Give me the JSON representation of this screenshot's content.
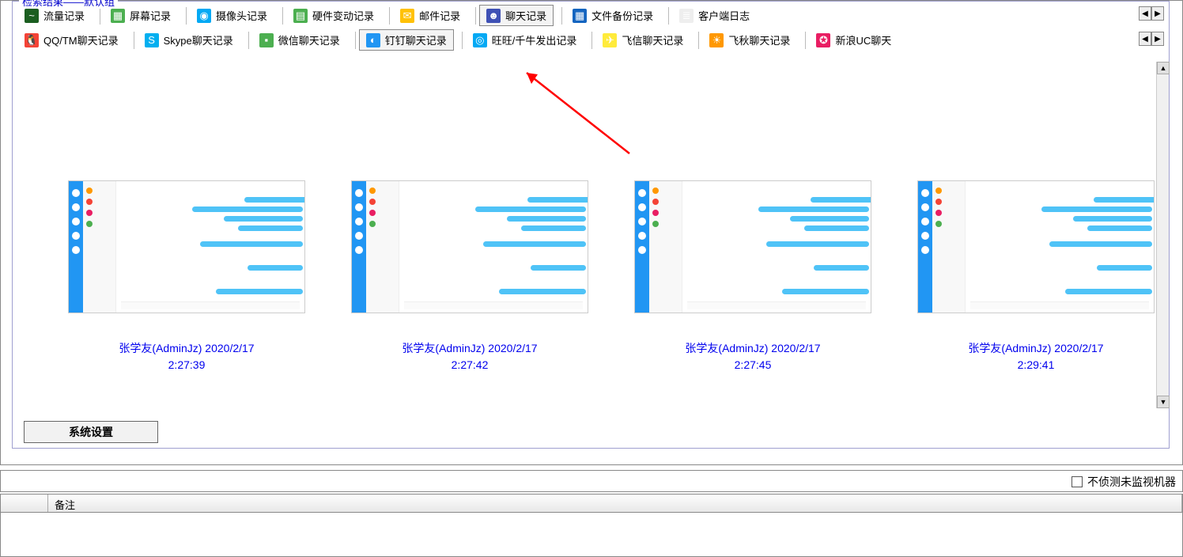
{
  "group_title": "检索结果——默认组",
  "toolbar_row1": [
    {
      "icon_bg": "#1b5e20",
      "icon_txt": "~",
      "label": "流量记录"
    },
    {
      "icon_bg": "#4caf50",
      "icon_txt": "▦",
      "label": "屏幕记录"
    },
    {
      "icon_bg": "#03a9f4",
      "icon_txt": "◉",
      "label": "摄像头记录"
    },
    {
      "icon_bg": "#4caf50",
      "icon_txt": "▤",
      "label": "硬件变动记录"
    },
    {
      "icon_bg": "#ffc107",
      "icon_txt": "✉",
      "label": "邮件记录"
    },
    {
      "icon_bg": "#3f51b5",
      "icon_txt": "☻",
      "label": "聊天记录",
      "active": true
    },
    {
      "icon_bg": "#1565c0",
      "icon_txt": "▦",
      "label": "文件备份记录"
    },
    {
      "icon_bg": "#eeeeee",
      "icon_txt": "≣",
      "label": "客户端日志"
    }
  ],
  "toolbar_row2": [
    {
      "icon_bg": "#f44336",
      "icon_txt": "🐧",
      "label": "QQ/TM聊天记录"
    },
    {
      "icon_bg": "#00aff0",
      "icon_txt": "S",
      "label": "Skype聊天记录"
    },
    {
      "icon_bg": "#4caf50",
      "icon_txt": "▪",
      "label": "微信聊天记录"
    },
    {
      "icon_bg": "#2196f3",
      "icon_txt": "◐",
      "label": "钉钉聊天记录",
      "active": true
    },
    {
      "icon_bg": "#03a9f4",
      "icon_txt": "◎",
      "label": "旺旺/千牛发出记录"
    },
    {
      "icon_bg": "#ffeb3b",
      "icon_txt": "✈",
      "label": "飞信聊天记录"
    },
    {
      "icon_bg": "#ff9800",
      "icon_txt": "☀",
      "label": "飞秋聊天记录"
    },
    {
      "icon_bg": "#e91e63",
      "icon_txt": "✪",
      "label": "新浪UC聊天"
    }
  ],
  "thumbnails": [
    {
      "line1": "张学友(AdminJz) 2020/2/17",
      "line2": "2:27:39"
    },
    {
      "line1": "张学友(AdminJz) 2020/2/17",
      "line2": "2:27:42"
    },
    {
      "line1": "张学友(AdminJz) 2020/2/17",
      "line2": "2:27:45"
    },
    {
      "line1": "张学友(AdminJz) 2020/2/17",
      "line2": "2:29:41"
    }
  ],
  "settings_button": "系统设置",
  "checkbox_label": "不侦测未监视机器",
  "table_header_col1": "",
  "table_header_col2": "备注",
  "nav_left": "◀",
  "nav_right": "▶",
  "scroll_up": "▲",
  "scroll_down": "▼"
}
